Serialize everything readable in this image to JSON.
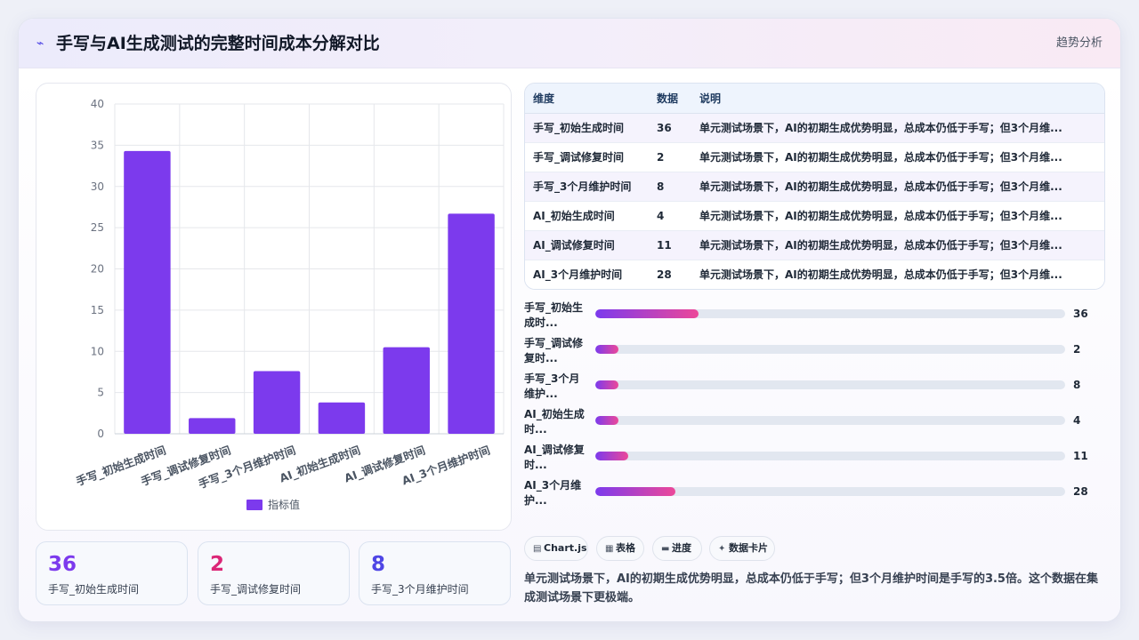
{
  "header": {
    "title": "手写与AI生成测试的完整时间成本分解对比",
    "action": "趋势分析",
    "logo_icon": "spark-icon"
  },
  "chart_data": {
    "type": "bar",
    "categories": [
      "手写_初始生成时间",
      "手写_调试修复时间",
      "手写_3个月维护时间",
      "AI_初始生成时间",
      "AI_调试修复时间",
      "AI_3个月维护时间"
    ],
    "series": [
      {
        "name": "指标值",
        "values": [
          34.3,
          1.9,
          7.6,
          3.8,
          10.5,
          26.7
        ]
      }
    ],
    "ylim": [
      0,
      40
    ],
    "yticks": [
      0,
      5,
      10,
      15,
      20,
      25,
      30,
      35,
      40
    ],
    "grid": true,
    "legend_position": "bottom",
    "bar_color": "#7c3aed"
  },
  "kpis": [
    {
      "value": "36",
      "label": "手写_初始生成时间",
      "color": "#7c3aed"
    },
    {
      "value": "2",
      "label": "手写_调试修复时间",
      "color": "#db2777"
    },
    {
      "value": "8",
      "label": "手写_3个月维护时间",
      "color": "#4f46e5"
    }
  ],
  "table": {
    "headers": [
      "维度",
      "数据",
      "说明"
    ],
    "rows": [
      [
        "手写_初始生成时间",
        "36",
        "单元测试场景下，AI的初期生成优势明显，总成本仍低于手写；但3个月维..."
      ],
      [
        "手写_调试修复时间",
        "2",
        "单元测试场景下，AI的初期生成优势明显，总成本仍低于手写；但3个月维..."
      ],
      [
        "手写_3个月维护时间",
        "8",
        "单元测试场景下，AI的初期生成优势明显，总成本仍低于手写；但3个月维..."
      ],
      [
        "AI_初始生成时间",
        "4",
        "单元测试场景下，AI的初期生成优势明显，总成本仍低于手写；但3个月维..."
      ],
      [
        "AI_调试修复时间",
        "11",
        "单元测试场景下，AI的初期生成优势明显，总成本仍低于手写；但3个月维..."
      ],
      [
        "AI_3个月维护时间",
        "28",
        "单元测试场景下，AI的初期生成优势明显，总成本仍低于手写；但3个月维..."
      ]
    ]
  },
  "progress": [
    {
      "label": "手写_初始生成时...",
      "value": 36,
      "fraction": 0.22
    },
    {
      "label": "手写_调试修复时...",
      "value": 2,
      "fraction": 0.05
    },
    {
      "label": "手写_3个月维护...",
      "value": 8,
      "fraction": 0.05
    },
    {
      "label": "AI_初始生成时...",
      "value": 4,
      "fraction": 0.05
    },
    {
      "label": "AI_调试修复时...",
      "value": 11,
      "fraction": 0.07
    },
    {
      "label": "AI_3个月维护...",
      "value": 28,
      "fraction": 0.17
    }
  ],
  "tags": [
    {
      "icon": "chart-icon",
      "glyph": "▤",
      "label": "Chart.js"
    },
    {
      "icon": "table-icon",
      "glyph": "▦",
      "label": "表格"
    },
    {
      "icon": "progress-icon",
      "glyph": "▬",
      "label": "进度"
    },
    {
      "icon": "card-icon",
      "glyph": "✦",
      "label": "数据卡片"
    }
  ],
  "note": "单元测试场景下，AI的初期生成优势明显，总成本仍低于手写；但3个月维护时间是手写的3.5倍。这个数据在集成测试场景下更极端。"
}
